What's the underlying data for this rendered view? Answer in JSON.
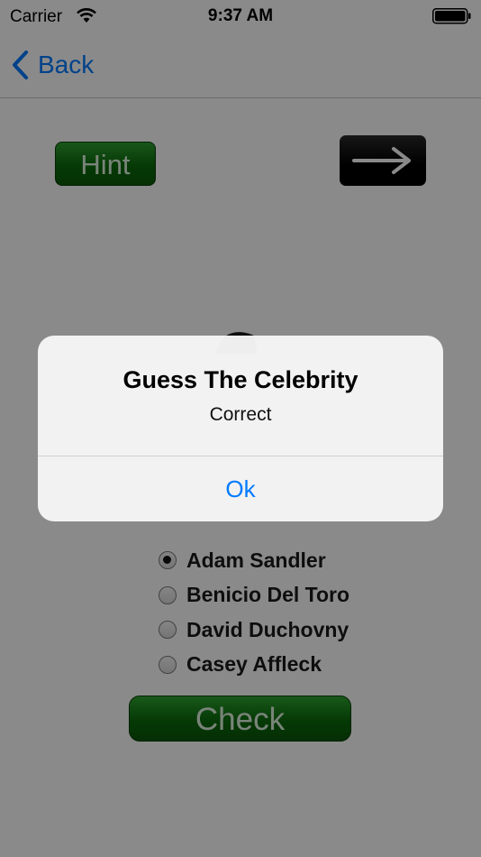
{
  "status_bar": {
    "carrier": "Carrier",
    "time": "9:37 AM"
  },
  "nav": {
    "back_label": "Back"
  },
  "game": {
    "hint_label": "Hint",
    "next_icon": "arrow-right-icon",
    "options": [
      {
        "label": "Adam Sandler",
        "selected": true
      },
      {
        "label": "Benicio Del Toro",
        "selected": false
      },
      {
        "label": "David Duchovny",
        "selected": false
      },
      {
        "label": "Casey Affleck",
        "selected": false
      }
    ],
    "check_label": "Check"
  },
  "alert": {
    "title": "Guess The Celebrity",
    "message": "Correct",
    "ok_label": "Ok"
  },
  "colors": {
    "accent": "#007aff",
    "button_green": "#0b6a0b",
    "overlay": "rgba(0,0,0,0.46)"
  }
}
